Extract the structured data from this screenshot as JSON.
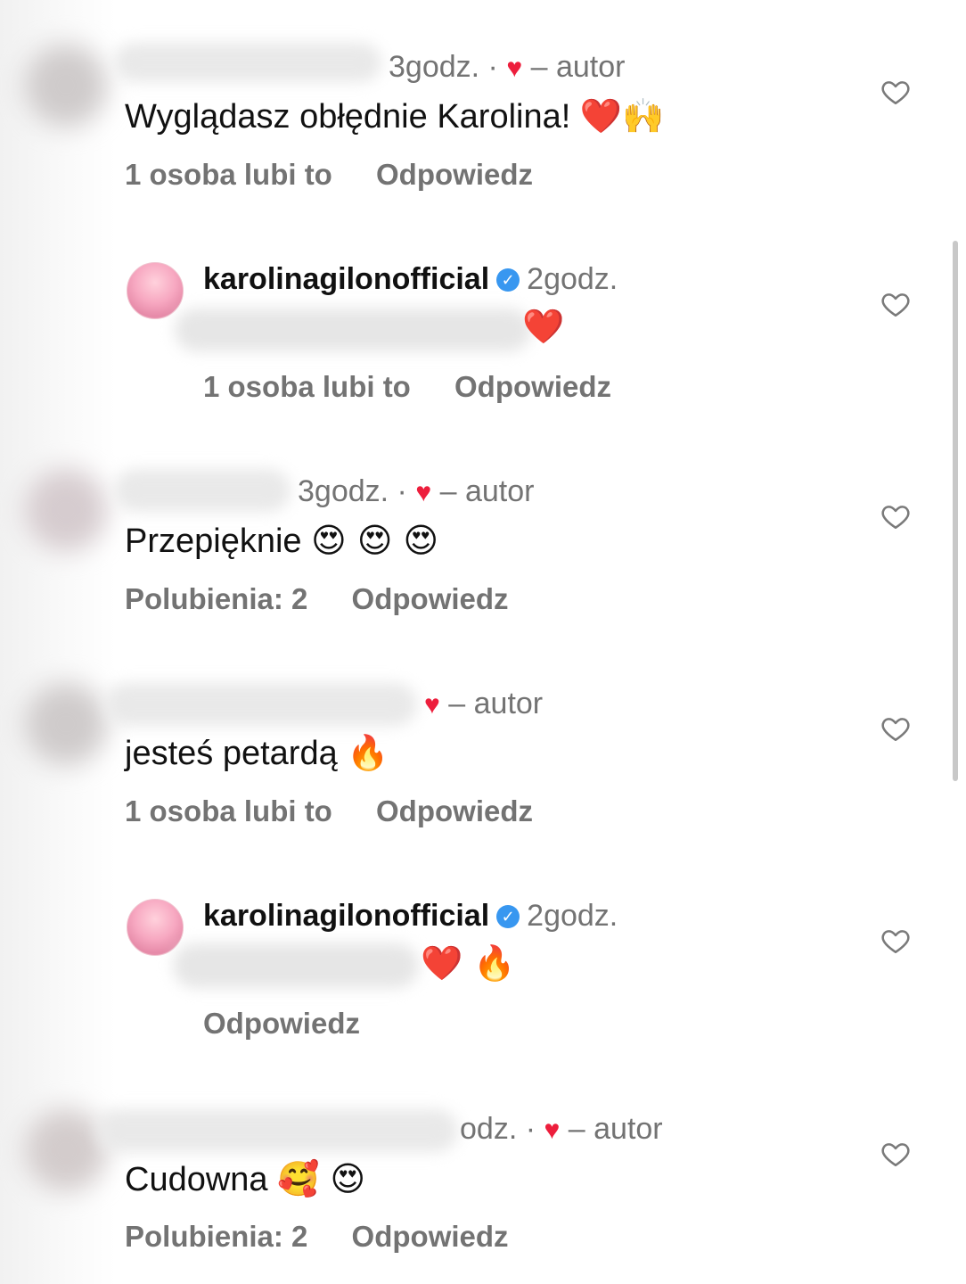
{
  "comments": [
    {
      "meta_time": "3godz.",
      "meta_sep": "·",
      "author_label": "– autor",
      "text": "Wyglądasz obłędnie Karolina!",
      "emojis": "❤️🙌",
      "likes": "1 osoba lubi to",
      "reply": "Odpowiedz"
    },
    {
      "username": "karolinagilonofficial",
      "time": "2godz.",
      "emojis": "❤️",
      "likes": "1 osoba lubi to",
      "reply": "Odpowiedz"
    },
    {
      "meta_time": "3godz.",
      "meta_sep": "·",
      "author_label": "– autor",
      "text": "Przepięknie",
      "emojis": "😍 😍 😍",
      "likes": "Polubienia: 2",
      "reply": "Odpowiedz"
    },
    {
      "author_label": "– autor",
      "text": "jesteś petardą",
      "emojis": "🔥",
      "likes": "1 osoba lubi to",
      "reply": "Odpowiedz"
    },
    {
      "username": "karolinagilonofficial",
      "time": "2godz.",
      "emojis": "❤️ 🔥",
      "reply": "Odpowiedz"
    },
    {
      "meta_time": "odz.",
      "meta_sep": "·",
      "author_label": "– autor",
      "text": "Cudowna",
      "emojis": "🥰 😍",
      "likes": "Polubienia: 2",
      "reply": "Odpowiedz"
    }
  ],
  "icons": {
    "like": "heart-outline-icon",
    "liked_by_author": "heart-filled-icon",
    "verified": "verified-badge-icon"
  },
  "colors": {
    "author_heart": "#ed1e3c",
    "verified": "#3897f0",
    "muted_text": "#737373"
  }
}
